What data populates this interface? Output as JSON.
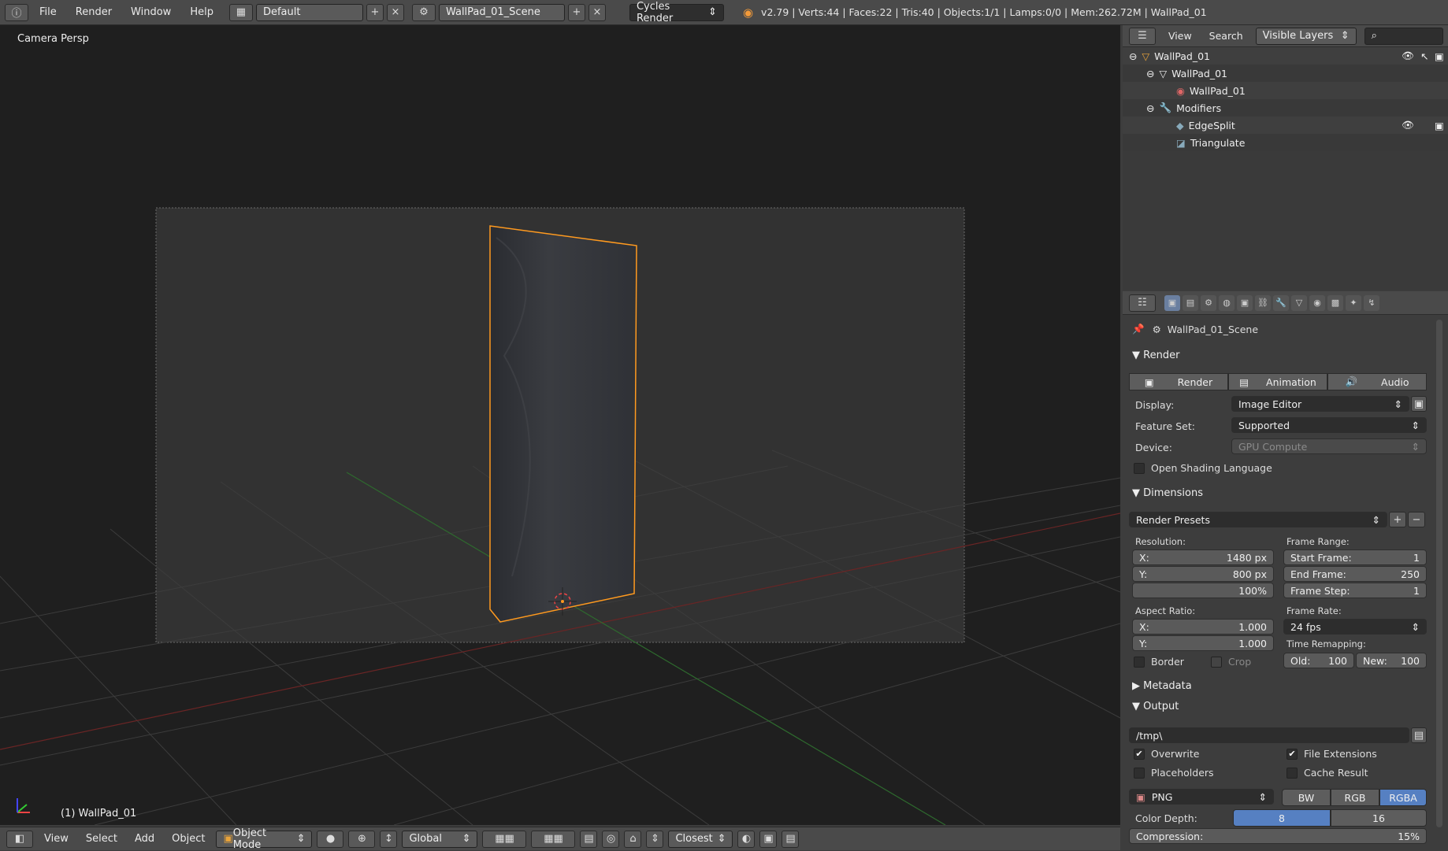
{
  "topbar": {
    "menus": [
      "File",
      "Render",
      "Window",
      "Help"
    ],
    "layout": "Default",
    "scene": "WallPad_01_Scene",
    "engine": "Cycles Render",
    "info": "v2.79 | Verts:44 | Faces:22 | Tris:40 | Objects:1/1 | Lamps:0/0 | Mem:262.72M | WallPad_01"
  },
  "viewport": {
    "label": "Camera Persp",
    "object_label": "(1) WallPad_01",
    "axis_x": "x",
    "axis_y": "y",
    "axis_z": "z"
  },
  "bottombar": {
    "menus": [
      "View",
      "Select",
      "Add",
      "Object"
    ],
    "mode": "Object Mode",
    "orientation": "Global",
    "snap": "Closest"
  },
  "outliner": {
    "header_menus": [
      "View",
      "Search"
    ],
    "filter": "Visible Layers",
    "items": [
      {
        "label": "WallPad_01",
        "indent": 0
      },
      {
        "label": "WallPad_01",
        "indent": 1
      },
      {
        "label": "WallPad_01",
        "indent": 2
      },
      {
        "label": "Modifiers",
        "indent": 1
      },
      {
        "label": "EdgeSplit",
        "indent": 2
      },
      {
        "label": "Triangulate",
        "indent": 2
      }
    ]
  },
  "properties": {
    "context": "WallPad_01_Scene",
    "render_panel": "Render",
    "render_buttons": [
      "Render",
      "Animation",
      "Audio"
    ],
    "display_label": "Display:",
    "display_value": "Image Editor",
    "featureset_label": "Feature Set:",
    "featureset_value": "Supported",
    "device_label": "Device:",
    "device_value": "GPU Compute",
    "osl_label": "Open Shading Language",
    "dimensions_panel": "Dimensions",
    "render_presets": "Render Presets",
    "resolution_label": "Resolution:",
    "res_x_label": "X:",
    "res_x": "1480 px",
    "res_y_label": "Y:",
    "res_y": "800 px",
    "res_pct": "100%",
    "frame_range_label": "Frame Range:",
    "start_label": "Start Frame:",
    "start": "1",
    "end_label": "End Frame:",
    "end": "250",
    "step_label": "Frame Step:",
    "step": "1",
    "aspect_label": "Aspect Ratio:",
    "asp_x_label": "X:",
    "asp_x": "1.000",
    "asp_y_label": "Y:",
    "asp_y": "1.000",
    "framerate_label": "Frame Rate:",
    "framerate": "24 fps",
    "remap_label": "Time Remapping:",
    "old_label": "Old:",
    "old": "100",
    "new_label": "New:",
    "new": "100",
    "border_label": "Border",
    "crop_label": "Crop",
    "metadata_panel": "Metadata",
    "output_panel": "Output",
    "output_path": "/tmp\\",
    "overwrite_label": "Overwrite",
    "file_ext_label": "File Extensions",
    "placeholders_label": "Placeholders",
    "cache_label": "Cache Result",
    "format": "PNG",
    "color_modes": [
      "BW",
      "RGB",
      "RGBA"
    ],
    "color_depth_label": "Color Depth:",
    "depth_8": "8",
    "depth_16": "16",
    "compression_label": "Compression:",
    "compression": "15%"
  },
  "colors": {
    "selection": "#ff9a1f",
    "accent": "#5680c2"
  }
}
